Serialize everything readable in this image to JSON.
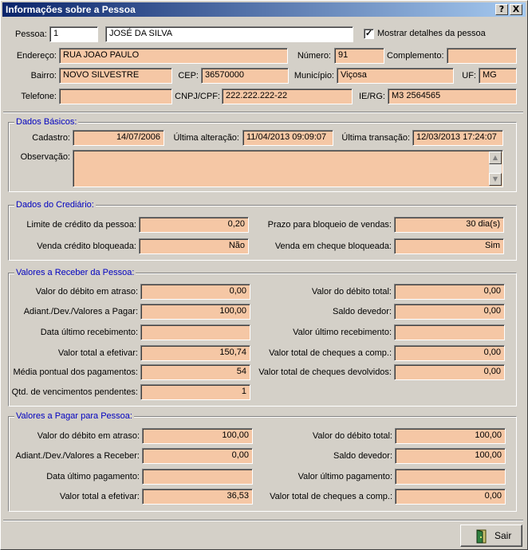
{
  "window": {
    "title": "Informações sobre a Pessoa",
    "help_label": "?",
    "close_label": "X"
  },
  "header": {
    "pessoa_label": "Pessoa:",
    "pessoa_code": "1",
    "pessoa_name": "JOSÉ DA SILVA",
    "show_details_checked": true,
    "show_details_label": "Mostrar detalhes da pessoa",
    "endereco_label": "Endereço:",
    "endereco": "RUA JOAO PAULO",
    "numero_label": "Número:",
    "numero": "91",
    "complemento_label": "Complemento:",
    "complemento": "",
    "bairro_label": "Bairro:",
    "bairro": "NOVO SILVESTRE",
    "cep_label": "CEP:",
    "cep": "36570000",
    "municipio_label": "Município:",
    "municipio": "Viçosa",
    "uf_label": "UF:",
    "uf": "MG",
    "telefone_label": "Telefone:",
    "telefone": "",
    "cnpj_label": "CNPJ/CPF:",
    "cnpj": "222.222.222-22",
    "ie_label": "IE/RG:",
    "ie": "M3 2564565"
  },
  "basicos": {
    "title": "Dados Básicos:",
    "cadastro_label": "Cadastro:",
    "cadastro": "14/07/2006",
    "ultima_alteracao_label": "Última alteração:",
    "ultima_alteracao": "11/04/2013 09:09:07",
    "ultima_transacao_label": "Última transação:",
    "ultima_transacao": "12/03/2013 17:24:07",
    "observacao_label": "Observação:",
    "observacao": ""
  },
  "crediario": {
    "title": "Dados do Crediário:",
    "limite_label": "Limite de crédito da pessoa:",
    "limite": "0,20",
    "prazo_label": "Prazo para bloqueio de vendas:",
    "prazo": "30 dia(s)",
    "venda_credito_label": "Venda crédito bloqueada:",
    "venda_credito": "Não",
    "venda_cheque_label": "Venda em cheque bloqueada:",
    "venda_cheque": "Sim"
  },
  "receber": {
    "title": "Valores a Receber da Pessoa:",
    "debito_atraso_label": "Valor do débito em atraso:",
    "debito_atraso": "0,00",
    "debito_total_label": "Valor do débito total:",
    "debito_total": "0,00",
    "adiant_label": "Adiant./Dev./Valores a Pagar:",
    "adiant": "100,00",
    "saldo_label": "Saldo devedor:",
    "saldo": "0,00",
    "data_ultimo_label": "Data último recebimento:",
    "data_ultimo": "",
    "valor_ultimo_label": "Valor último recebimento:",
    "valor_ultimo": "",
    "total_efetivar_label": "Valor total a efetivar:",
    "total_efetivar": "150,74",
    "cheques_comp_label": "Valor total de cheques a comp.:",
    "cheques_comp": "0,00",
    "media_label": "Média pontual dos pagamentos:",
    "media": "54",
    "cheques_dev_label": "Valor total de cheques devolvidos:",
    "cheques_dev": "0,00",
    "qtd_label": "Qtd. de vencimentos pendentes:",
    "qtd": "1"
  },
  "pagar": {
    "title": "Valores a Pagar para Pessoa:",
    "debito_atraso_label": "Valor do débito em atraso:",
    "debito_atraso": "100,00",
    "debito_total_label": "Valor do débito total:",
    "debito_total": "100,00",
    "adiant_label": "Adiant./Dev./Valores a Receber:",
    "adiant": "0,00",
    "saldo_label": "Saldo devedor:",
    "saldo": "100,00",
    "data_ultimo_label": "Data último pagamento:",
    "data_ultimo": "",
    "valor_ultimo_label": "Valor último pagamento:",
    "valor_ultimo": "",
    "total_efetivar_label": "Valor total a efetivar:",
    "total_efetivar": "36,53",
    "cheques_comp_label": "Valor total de cheques a comp.:",
    "cheques_comp": "0,00"
  },
  "footer": {
    "sair_label": "Sair",
    "sair_icon": "exit-door-icon"
  },
  "colors": {
    "field_bg": "#f5c7a5",
    "group_title": "#0000c0",
    "titlebar": "#0a246a"
  }
}
